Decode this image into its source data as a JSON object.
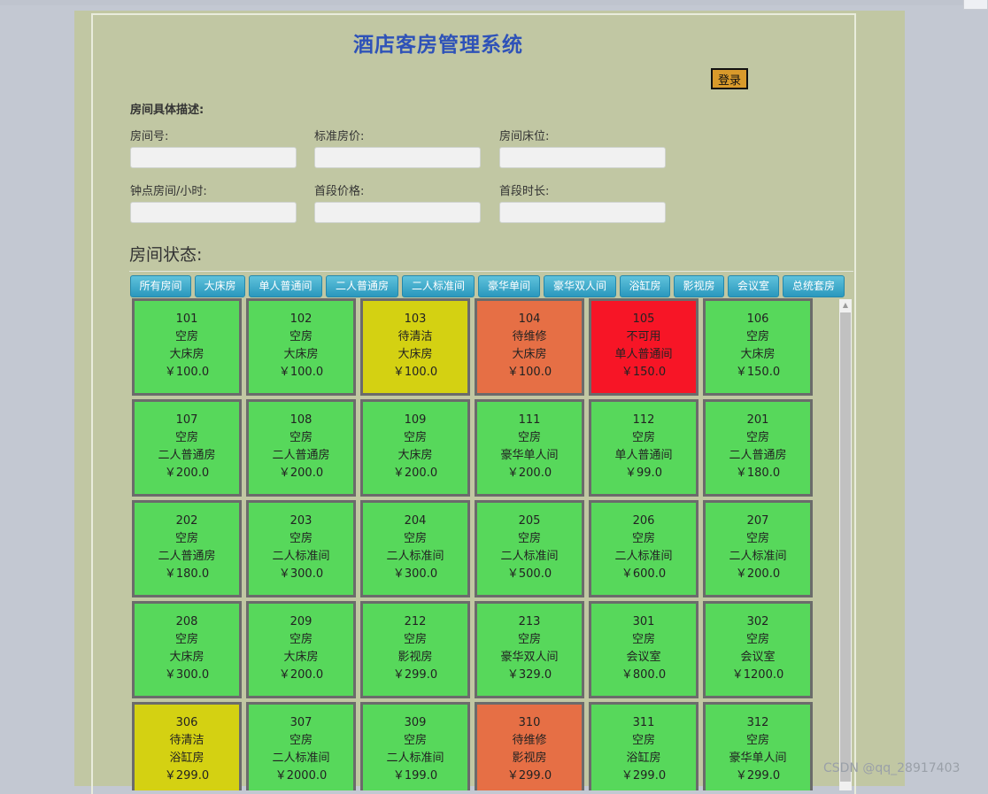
{
  "app": {
    "title": "酒店客房管理系统",
    "login_label": "登录"
  },
  "form": {
    "heading": "房间具体描述:",
    "fields": [
      {
        "label": "房间号:",
        "value": ""
      },
      {
        "label": "标准房价:",
        "value": ""
      },
      {
        "label": "房间床位:",
        "value": ""
      },
      {
        "label": "钟点房间/小时:",
        "value": ""
      },
      {
        "label": "首段价格:",
        "value": ""
      },
      {
        "label": "首段时长:",
        "value": ""
      }
    ]
  },
  "status": {
    "heading": "房间状态:",
    "tabs": [
      "所有房间",
      "大床房",
      "单人普通间",
      "二人普通房",
      "二人标准间",
      "豪华单间",
      "豪华双人间",
      "浴缸房",
      "影视房",
      "会议室",
      "总统套房"
    ]
  },
  "status_colors": {
    "空房": "#57d85b",
    "待清洁": "#d4d112",
    "待维修": "#e66f45",
    "不可用": "#f71526"
  },
  "rooms": [
    {
      "number": "101",
      "status": "空房",
      "type": "大床房",
      "price": "￥100.0"
    },
    {
      "number": "102",
      "status": "空房",
      "type": "大床房",
      "price": "￥100.0"
    },
    {
      "number": "103",
      "status": "待清洁",
      "type": "大床房",
      "price": "￥100.0"
    },
    {
      "number": "104",
      "status": "待维修",
      "type": "大床房",
      "price": "￥100.0"
    },
    {
      "number": "105",
      "status": "不可用",
      "type": "单人普通间",
      "price": "￥150.0"
    },
    {
      "number": "106",
      "status": "空房",
      "type": "大床房",
      "price": "￥150.0"
    },
    {
      "number": "107",
      "status": "空房",
      "type": "二人普通房",
      "price": "￥200.0"
    },
    {
      "number": "108",
      "status": "空房",
      "type": "二人普通房",
      "price": "￥200.0"
    },
    {
      "number": "109",
      "status": "空房",
      "type": "大床房",
      "price": "￥200.0"
    },
    {
      "number": "111",
      "status": "空房",
      "type": "豪华单人间",
      "price": "￥200.0"
    },
    {
      "number": "112",
      "status": "空房",
      "type": "单人普通间",
      "price": "￥99.0"
    },
    {
      "number": "201",
      "status": "空房",
      "type": "二人普通房",
      "price": "￥180.0"
    },
    {
      "number": "202",
      "status": "空房",
      "type": "二人普通房",
      "price": "￥180.0"
    },
    {
      "number": "203",
      "status": "空房",
      "type": "二人标准间",
      "price": "￥300.0"
    },
    {
      "number": "204",
      "status": "空房",
      "type": "二人标准间",
      "price": "￥300.0"
    },
    {
      "number": "205",
      "status": "空房",
      "type": "二人标准间",
      "price": "￥500.0"
    },
    {
      "number": "206",
      "status": "空房",
      "type": "二人标准间",
      "price": "￥600.0"
    },
    {
      "number": "207",
      "status": "空房",
      "type": "二人标准间",
      "price": "￥200.0"
    },
    {
      "number": "208",
      "status": "空房",
      "type": "大床房",
      "price": "￥300.0"
    },
    {
      "number": "209",
      "status": "空房",
      "type": "大床房",
      "price": "￥200.0"
    },
    {
      "number": "212",
      "status": "空房",
      "type": "影视房",
      "price": "￥299.0"
    },
    {
      "number": "213",
      "status": "空房",
      "type": "豪华双人间",
      "price": "￥329.0"
    },
    {
      "number": "301",
      "status": "空房",
      "type": "会议室",
      "price": "￥800.0"
    },
    {
      "number": "302",
      "status": "空房",
      "type": "会议室",
      "price": "￥1200.0"
    },
    {
      "number": "306",
      "status": "待清洁",
      "type": "浴缸房",
      "price": "￥299.0"
    },
    {
      "number": "307",
      "status": "空房",
      "type": "二人标准间",
      "price": "￥2000.0"
    },
    {
      "number": "309",
      "status": "空房",
      "type": "二人标准间",
      "price": "￥199.0"
    },
    {
      "number": "310",
      "status": "待维修",
      "type": "影视房",
      "price": "￥299.0"
    },
    {
      "number": "311",
      "status": "空房",
      "type": "浴缸房",
      "price": "￥299.0"
    },
    {
      "number": "312",
      "status": "空房",
      "type": "豪华单人间",
      "price": "￥299.0"
    }
  ],
  "watermark": "CSDN @qq_28917403"
}
